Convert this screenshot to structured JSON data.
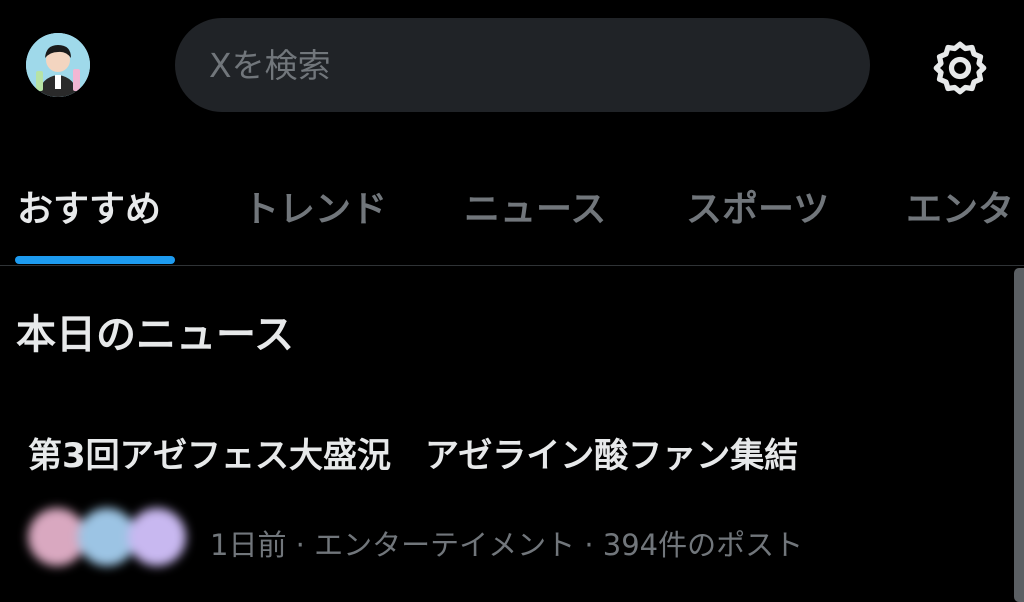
{
  "search": {
    "placeholder": "Xを検索"
  },
  "tabs": [
    {
      "label": "おすすめ",
      "active": true
    },
    {
      "label": "トレンド",
      "active": false
    },
    {
      "label": "ニュース",
      "active": false
    },
    {
      "label": "スポーツ",
      "active": false
    },
    {
      "label": "エンタ",
      "active": false
    }
  ],
  "section": {
    "title": "本日のニュース"
  },
  "news": {
    "headline": "第3回アゼフェス大盛況　アゼライン酸ファン集結",
    "meta": "1日前 · エンターテイメント · 394件のポスト"
  },
  "colors": {
    "background": "#000000",
    "accent": "#1d9bf0",
    "primary_text": "#e7e9ea",
    "secondary_text": "#71767b",
    "search_background": "#202327"
  },
  "icons": {
    "settings": "gear-icon",
    "avatar": "avatar"
  }
}
